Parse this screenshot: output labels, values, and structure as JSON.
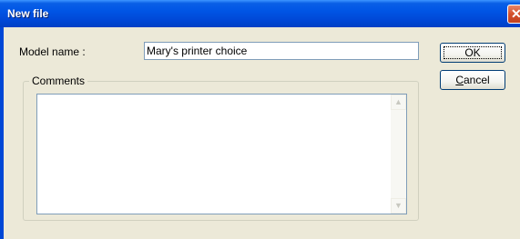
{
  "window": {
    "title": "New file",
    "close_glyph": "✕"
  },
  "form": {
    "model_label": "Model name :",
    "model_value": "Mary's printer choice",
    "comments_legend": "Comments",
    "comments_value": ""
  },
  "buttons": {
    "ok_label": "OK",
    "cancel_first": "C",
    "cancel_rest": "ancel"
  },
  "scrollbar": {
    "up_glyph": "▲",
    "down_glyph": "▼"
  }
}
